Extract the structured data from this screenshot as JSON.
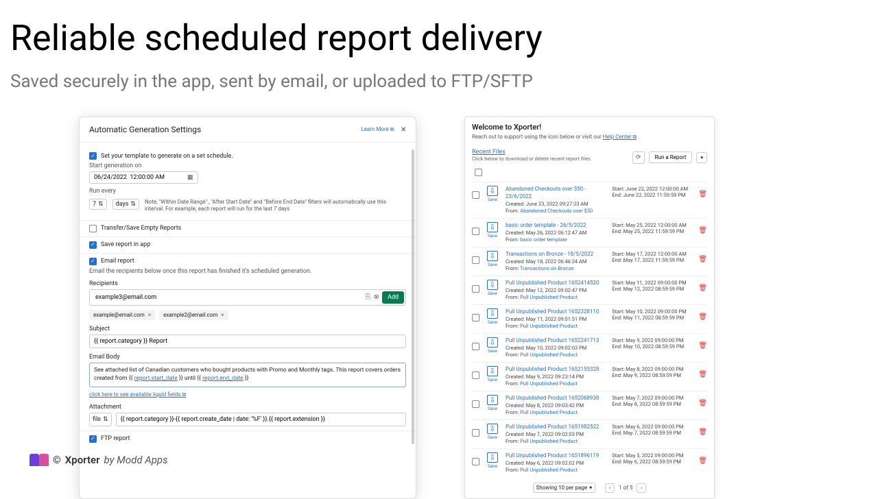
{
  "hero": {
    "title": "Reliable scheduled report delivery",
    "subtitle": "Saved securely in the app, sent by email, or uploaded to FTP/SFTP"
  },
  "footer": {
    "copyright": "©",
    "brand": "Xporter",
    "by": "by Modd Apps"
  },
  "modal": {
    "title": "Automatic Generation Settings",
    "learn_more": "Learn More ⧉",
    "schedule_label": "Set your template to generate on a set schedule.",
    "start_label": "Start generation on",
    "start_value": "06/24/2022  12:00:00 AM",
    "run_every_label": "Run every",
    "run_every_value": "7",
    "run_every_unit": "days",
    "run_every_note": "Note, \"Within Date Range\" , \"After Start Date\" and \"Before End Date\" filters will automatically use this interval. For example, each report will run for the last 7 days",
    "transfer_empty": "Transfer/Save Empty Reports",
    "save_in_app": "Save report in app",
    "email_report": "Email report",
    "email_hint": "Email the recipients below once this report has finished it's scheduled generation.",
    "recipients_label": "Recipients",
    "recipient_input": "example3@email.com",
    "add_btn": "Add",
    "chips": [
      "example@email.com",
      "example2@email.com"
    ],
    "subject_label": "Subject",
    "subject_value": "{{ report.category }} Report",
    "body_label": "Email Body",
    "body_text_pre": "See attached list of Canadian customers who bought products with Promo and Monthly tags.  This report covers orders created from {{ ",
    "body_var1": "report.start_date",
    "body_text_mid": " }} until {{ ",
    "body_var2": "report.end_date",
    "body_text_post": " }}",
    "liquid_link": "click here to see available liquid fields ⧉",
    "attachment_label": "Attachment",
    "attachment_mode": "file",
    "attachment_value": "{{ report.category }}-{{ report.create_date | date: '%F' }}.{{ report.extension }}",
    "ftp_label": "FTP report"
  },
  "dash": {
    "title": "Welcome to Xporter!",
    "sub_pre": "Reach out to support using the icon below or visit our ",
    "sub_link": "Help Center ⧉",
    "sub_post": " .",
    "recent": "Recent Files",
    "hint": "Click below to download or delete recent report files",
    "run": "Run a Report",
    "save": "Save",
    "from": "From:",
    "created": "Created:",
    "start": "Start:",
    "end": "End:",
    "files": [
      {
        "name": "Abandoned Checkouts over $50 - 23/6/2022",
        "created": "June 23, 2022 09:27:33 AM",
        "from": "Abandoned Checkouts over $50",
        "start": "June 22, 2022 12:00:00 AM",
        "end": "June 22, 2022 11:59:59 PM"
      },
      {
        "name": "basic order template - 26/5/2022",
        "created": "May 26, 2022 06:12:47 AM",
        "from": "basic order template",
        "start": "May 25, 2022 12:00:00 AM",
        "end": "May 25, 2022 11:59:59 PM"
      },
      {
        "name": "Transactions on Bronze - 18/5/2022",
        "created": "May 18, 2022 06:46:24 AM",
        "from": "Transactions on Bronze",
        "start": "May 17, 2022 12:00:00 AM",
        "end": "May 17, 2022 11:59:59 PM"
      },
      {
        "name": "Pull Unpublished Product 1652414520",
        "created": "May 12, 2022 09:02:47 PM",
        "from": "Pull Unpublished Product",
        "start": "May 11, 2022 09:00:00 PM",
        "end": "May 12, 2022 08:59:59 PM"
      },
      {
        "name": "Pull Unpublished Product 1652328110",
        "created": "May 11, 2022 09:01:51 PM",
        "from": "Pull Unpublished Product",
        "start": "May 10, 2022 09:00:00 PM",
        "end": "May 11, 2022 08:59:59 PM"
      },
      {
        "name": "Pull Unpublished Product 1652241713",
        "created": "May 10, 2022 09:02:03 PM",
        "from": "Pull Unpublished Product",
        "start": "May 9, 2022 09:00:00 PM",
        "end": "May 10, 2022 08:59:59 PM"
      },
      {
        "name": "Pull Unpublished Product 1652155328",
        "created": "May 9, 2022 09:23:14 PM",
        "from": "Pull Unpublished Product",
        "start": "May 8, 2022 09:00:00 PM",
        "end": "May 9, 2022 08:59:59 PM"
      },
      {
        "name": "Pull Unpublished Product 1652068938",
        "created": "May 8, 2022 09:03:42 PM",
        "from": "Pull Unpublished Product",
        "start": "May 7, 2022 09:00:00 PM",
        "end": "May 8, 2022 08:59:59 PM"
      },
      {
        "name": "Pull Unpublished Product 1651982522",
        "created": "May 7, 2022 09:02:03 PM",
        "from": "Pull Unpublished Product",
        "start": "May 6, 2022 09:00:00 PM",
        "end": "May 7, 2022 08:59:59 PM"
      },
      {
        "name": "Pull Unpublished Product 1651896119",
        "created": "May 6, 2022 09:02:02 PM",
        "from": "Pull Unpublished Product",
        "start": "May 5, 2022 09:00:00 PM",
        "end": "May 6, 2022 08:59:59 PM"
      }
    ],
    "per_page": "Showing 10 per page",
    "page_of": "1 of 5"
  }
}
